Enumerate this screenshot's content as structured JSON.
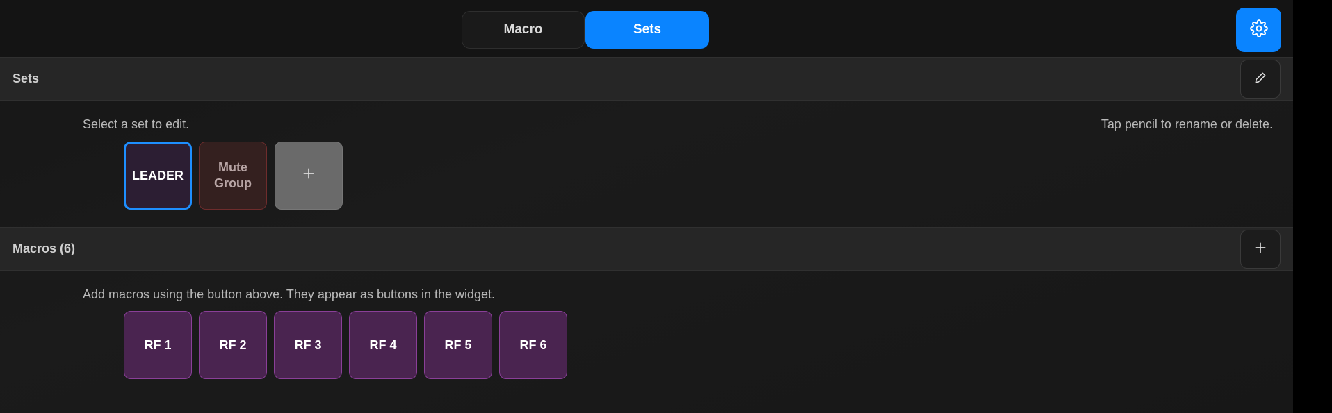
{
  "tabs": {
    "macro_label": "Macro",
    "sets_label": "Sets",
    "active": "Sets"
  },
  "sets_section": {
    "title": "Sets",
    "hint_left": "Select a set to edit.",
    "hint_right": "Tap pencil to rename or delete.",
    "sets": [
      {
        "label": "LEADER",
        "selected": true
      },
      {
        "label": "Mute Group",
        "selected": false
      }
    ],
    "add_icon": "plus-icon",
    "edit_icon": "pencil-icon"
  },
  "macros_section": {
    "title": "Macros (6)",
    "hint": "Add macros using the button above. They appear as buttons in the widget.",
    "macros": [
      "RF 1",
      "RF 2",
      "RF 3",
      "RF 4",
      "RF 5",
      "RF 6"
    ],
    "add_icon": "plus-icon"
  },
  "settings_icon": "gear-icon",
  "colors": {
    "accent": "#0a84ff",
    "macro_tile": "#4a2450",
    "mute_tile": "#34201f"
  }
}
